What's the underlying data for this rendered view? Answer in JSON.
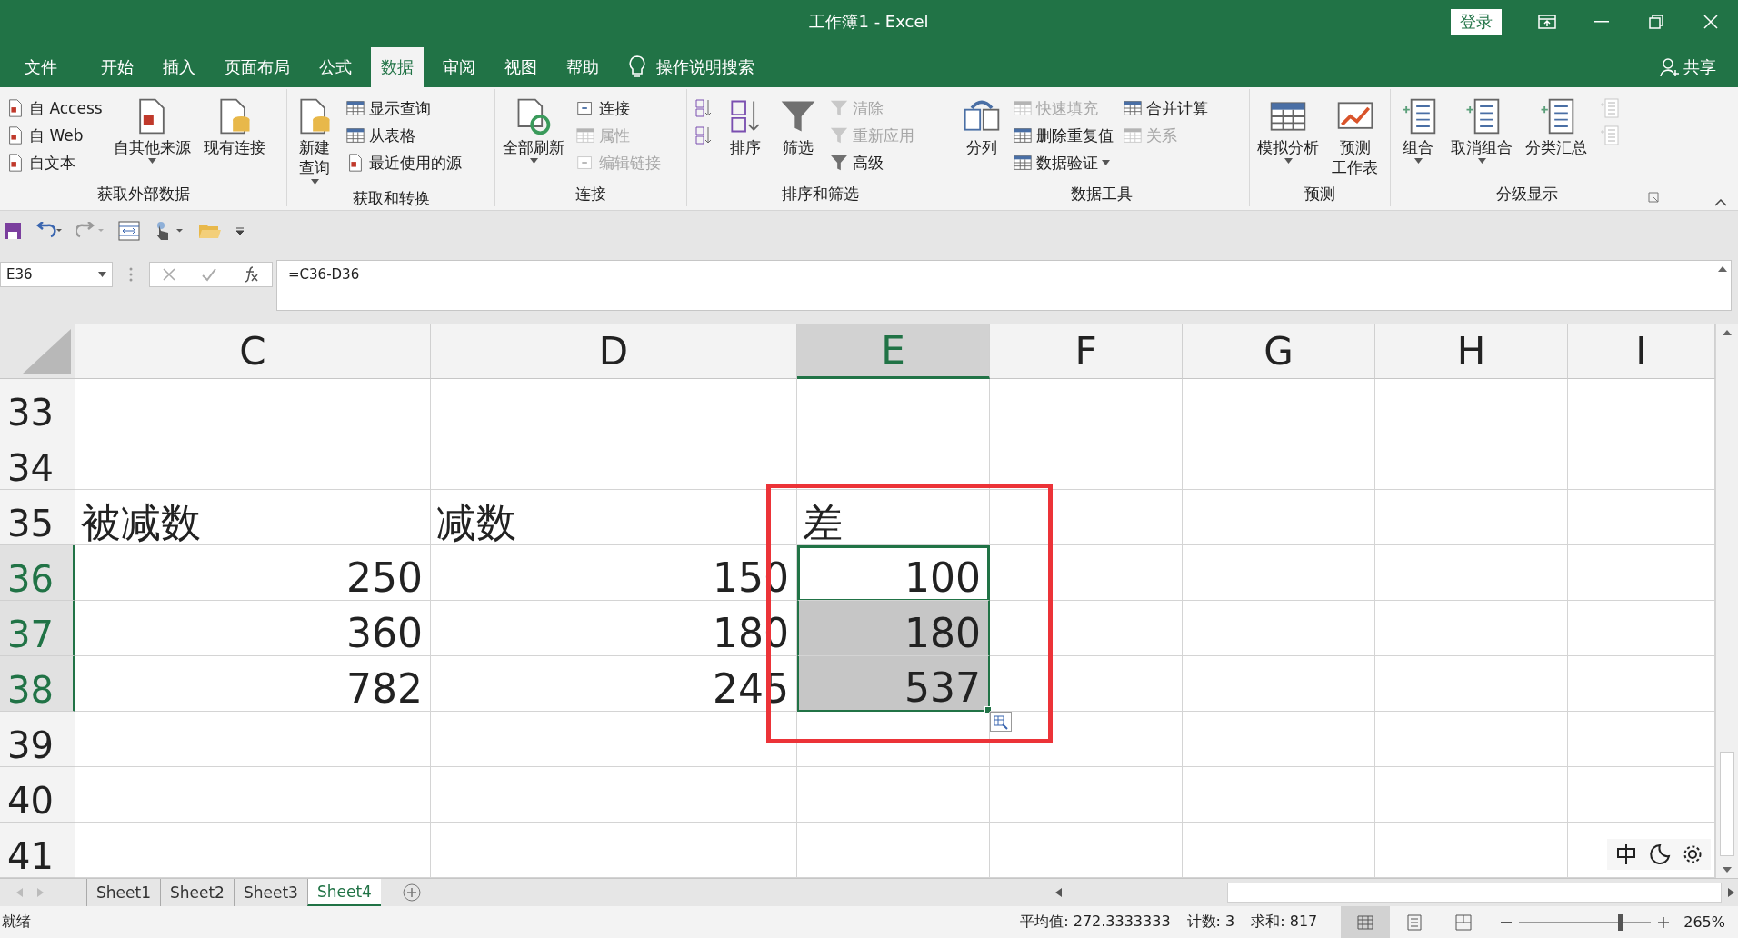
{
  "window": {
    "title": "工作簿1  -  Excel",
    "sign_in": "登录"
  },
  "menu_tabs": [
    {
      "label": "文件",
      "selected": false
    },
    {
      "label": "开始",
      "selected": false
    },
    {
      "label": "插入",
      "selected": false
    },
    {
      "label": "页面布局",
      "selected": false
    },
    {
      "label": "公式",
      "selected": false
    },
    {
      "label": "数据",
      "selected": true
    },
    {
      "label": "审阅",
      "selected": false
    },
    {
      "label": "视图",
      "selected": false
    },
    {
      "label": "帮助",
      "selected": false
    }
  ],
  "tell_me": "操作说明搜索",
  "share": "共享",
  "ribbon_groups": [
    {
      "label": "获取外部数据",
      "columns": [
        {
          "kind": "stack",
          "items": [
            {
              "label": "自 Access",
              "disabled": false,
              "dropdown": false
            },
            {
              "label": "自 Web",
              "disabled": false,
              "dropdown": false
            },
            {
              "label": "自文本",
              "disabled": false,
              "dropdown": false
            }
          ]
        },
        {
          "kind": "large",
          "items": [
            {
              "label": "自其他来源",
              "disabled": false,
              "dropdown": true
            }
          ]
        },
        {
          "kind": "large",
          "items": [
            {
              "label": "现有连接",
              "disabled": false,
              "dropdown": false
            }
          ]
        }
      ]
    },
    {
      "label": "获取和转换",
      "columns": [
        {
          "kind": "large",
          "items": [
            {
              "lines": [
                "新建",
                "查询"
              ],
              "disabled": false,
              "dropdown": true
            }
          ]
        },
        {
          "kind": "stack",
          "items": [
            {
              "label": "显示查询",
              "disabled": false,
              "dropdown": false
            },
            {
              "label": "从表格",
              "disabled": false,
              "dropdown": false
            },
            {
              "label": "最近使用的源",
              "disabled": false,
              "dropdown": false
            }
          ]
        }
      ]
    },
    {
      "label": "连接",
      "columns": [
        {
          "kind": "large",
          "items": [
            {
              "label": "全部刷新",
              "disabled": false,
              "dropdown": true
            }
          ]
        },
        {
          "kind": "stack",
          "items": [
            {
              "label": "连接",
              "disabled": false,
              "dropdown": false
            },
            {
              "label": "属性",
              "disabled": true,
              "dropdown": false
            },
            {
              "label": "编辑链接",
              "disabled": true,
              "dropdown": false
            }
          ]
        }
      ]
    },
    {
      "label": "排序和筛选",
      "columns": [
        {
          "kind": "stack",
          "items": [
            {
              "disabled": false,
              "dropdown": false
            },
            {
              "disabled": false,
              "dropdown": false
            }
          ]
        },
        {
          "kind": "large",
          "items": [
            {
              "label": "排序",
              "disabled": false,
              "dropdown": false
            }
          ]
        },
        {
          "kind": "large",
          "items": [
            {
              "label": "筛选",
              "disabled": false,
              "dropdown": false
            }
          ]
        },
        {
          "kind": "stack",
          "items": [
            {
              "label": "清除",
              "disabled": true,
              "dropdown": false
            },
            {
              "label": "重新应用",
              "disabled": true,
              "dropdown": false
            },
            {
              "label": "高级",
              "disabled": false,
              "dropdown": false
            }
          ]
        }
      ]
    },
    {
      "label": "数据工具",
      "columns": [
        {
          "kind": "large",
          "items": [
            {
              "label": "分列",
              "disabled": false,
              "dropdown": false
            }
          ]
        },
        {
          "kind": "stack",
          "items": [
            {
              "label": "快速填充",
              "disabled": true,
              "dropdown": false
            },
            {
              "label": "删除重复值",
              "disabled": false,
              "dropdown": false
            },
            {
              "label": "数据验证",
              "disabled": false,
              "dropdown": true
            }
          ]
        },
        {
          "kind": "stack",
          "items": [
            {
              "label": "合并计算",
              "disabled": false,
              "dropdown": false
            },
            {
              "label": "关系",
              "disabled": true,
              "dropdown": false
            }
          ]
        }
      ]
    },
    {
      "label": "预测",
      "columns": [
        {
          "kind": "large",
          "items": [
            {
              "label": "模拟分析",
              "disabled": false,
              "dropdown": true
            }
          ]
        },
        {
          "kind": "large",
          "items": [
            {
              "lines": [
                "预测",
                "工作表"
              ],
              "disabled": false,
              "dropdown": false
            }
          ]
        }
      ]
    },
    {
      "label": "分级显示",
      "columns": [
        {
          "kind": "large",
          "items": [
            {
              "label": "组合",
              "disabled": false,
              "dropdown": true
            }
          ]
        },
        {
          "kind": "large",
          "items": [
            {
              "label": "取消组合",
              "disabled": false,
              "dropdown": true
            }
          ]
        },
        {
          "kind": "large",
          "items": [
            {
              "label": "分类汇总",
              "disabled": false,
              "dropdown": false
            }
          ]
        },
        {
          "kind": "stack",
          "items": [
            {
              "disabled": true,
              "dropdown": false
            },
            {
              "disabled": true,
              "dropdown": false
            }
          ]
        }
      ]
    }
  ],
  "formula_bar": {
    "name_box": "E36",
    "formula": "=C36-D36"
  },
  "columns": [
    {
      "label": "C",
      "selected": false
    },
    {
      "label": "D",
      "selected": false
    },
    {
      "label": "E",
      "selected": true
    },
    {
      "label": "F",
      "selected": false
    },
    {
      "label": "G",
      "selected": false
    },
    {
      "label": "H",
      "selected": false
    },
    {
      "label": "I",
      "selected": false
    }
  ],
  "rows": [
    {
      "number": "33",
      "selected": false,
      "active": false,
      "kind": "empty",
      "cells": {}
    },
    {
      "number": "34",
      "selected": false,
      "active": false,
      "kind": "empty",
      "cells": {}
    },
    {
      "number": "35",
      "selected": false,
      "active": false,
      "kind": "text",
      "cells": {
        "c": "被减数",
        "d": "减数",
        "e": "差"
      }
    },
    {
      "number": "36",
      "selected": true,
      "active": true,
      "kind": "number",
      "cells": {
        "c": "250",
        "d": "150",
        "e": "100"
      }
    },
    {
      "number": "37",
      "selected": true,
      "active": false,
      "kind": "number",
      "cells": {
        "c": "360",
        "d": "180",
        "e": "180"
      }
    },
    {
      "number": "38",
      "selected": true,
      "active": false,
      "kind": "number",
      "cells": {
        "c": "782",
        "d": "245",
        "e": "537"
      }
    },
    {
      "number": "39",
      "selected": false,
      "active": false,
      "kind": "empty",
      "cells": {}
    },
    {
      "number": "40",
      "selected": false,
      "active": false,
      "kind": "empty",
      "cells": {}
    },
    {
      "number": "41",
      "selected": false,
      "active": false,
      "kind": "empty",
      "cells": {}
    }
  ],
  "sheet_tabs": [
    {
      "label": "Sheet1",
      "selected": false
    },
    {
      "label": "Sheet2",
      "selected": false
    },
    {
      "label": "Sheet3",
      "selected": false
    },
    {
      "label": "Sheet4",
      "selected": true
    }
  ],
  "status_bar": {
    "mode": "就绪",
    "stats": [
      "平均值: 272.3333333",
      "计数: 3",
      "求和: 817"
    ],
    "views": [
      {
        "selected": true
      },
      {
        "selected": false
      },
      {
        "selected": false
      }
    ],
    "zoom": {
      "level": 0.77,
      "label": "265%"
    }
  }
}
